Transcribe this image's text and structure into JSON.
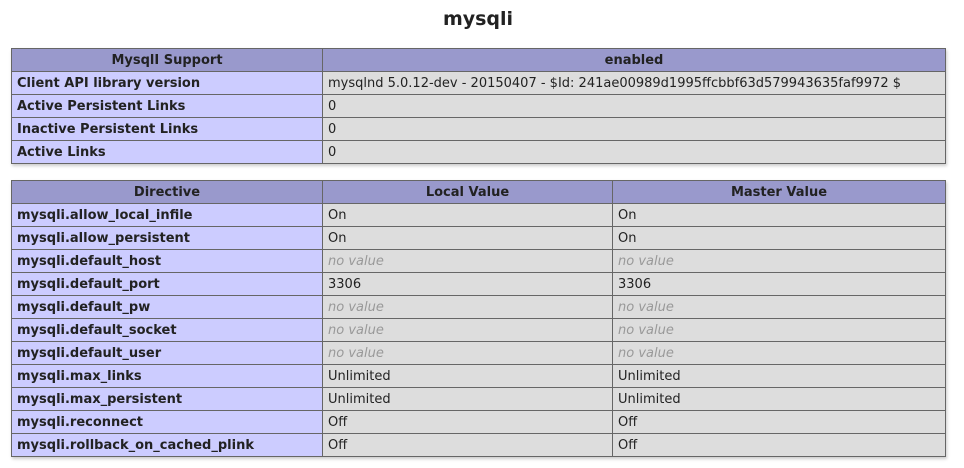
{
  "title": "mysqli",
  "support_table": {
    "header": [
      "MysqlI Support",
      "enabled"
    ],
    "rows": [
      {
        "name": "Client API library version",
        "value": "mysqlnd 5.0.12-dev - 20150407 - $Id: 241ae00989d1995ffcbbf63d579943635faf9972 $"
      },
      {
        "name": "Active Persistent Links",
        "value": "0"
      },
      {
        "name": "Inactive Persistent Links",
        "value": "0"
      },
      {
        "name": "Active Links",
        "value": "0"
      }
    ]
  },
  "directive_table": {
    "headers": [
      "Directive",
      "Local Value",
      "Master Value"
    ],
    "rows": [
      {
        "directive": "mysqli.allow_local_infile",
        "local": "On",
        "master": "On",
        "no_value": false
      },
      {
        "directive": "mysqli.allow_persistent",
        "local": "On",
        "master": "On",
        "no_value": false
      },
      {
        "directive": "mysqli.default_host",
        "local": "no value",
        "master": "no value",
        "no_value": true
      },
      {
        "directive": "mysqli.default_port",
        "local": "3306",
        "master": "3306",
        "no_value": false
      },
      {
        "directive": "mysqli.default_pw",
        "local": "no value",
        "master": "no value",
        "no_value": true
      },
      {
        "directive": "mysqli.default_socket",
        "local": "no value",
        "master": "no value",
        "no_value": true
      },
      {
        "directive": "mysqli.default_user",
        "local": "no value",
        "master": "no value",
        "no_value": true
      },
      {
        "directive": "mysqli.max_links",
        "local": "Unlimited",
        "master": "Unlimited",
        "no_value": false
      },
      {
        "directive": "mysqli.max_persistent",
        "local": "Unlimited",
        "master": "Unlimited",
        "no_value": false
      },
      {
        "directive": "mysqli.reconnect",
        "local": "Off",
        "master": "Off",
        "no_value": false
      },
      {
        "directive": "mysqli.rollback_on_cached_plink",
        "local": "Off",
        "master": "Off",
        "no_value": false
      }
    ]
  },
  "colors": {
    "header_bg": "#9999cc",
    "key_bg": "#ccccff",
    "value_bg": "#dddddd",
    "no_value_text": "#999999"
  }
}
